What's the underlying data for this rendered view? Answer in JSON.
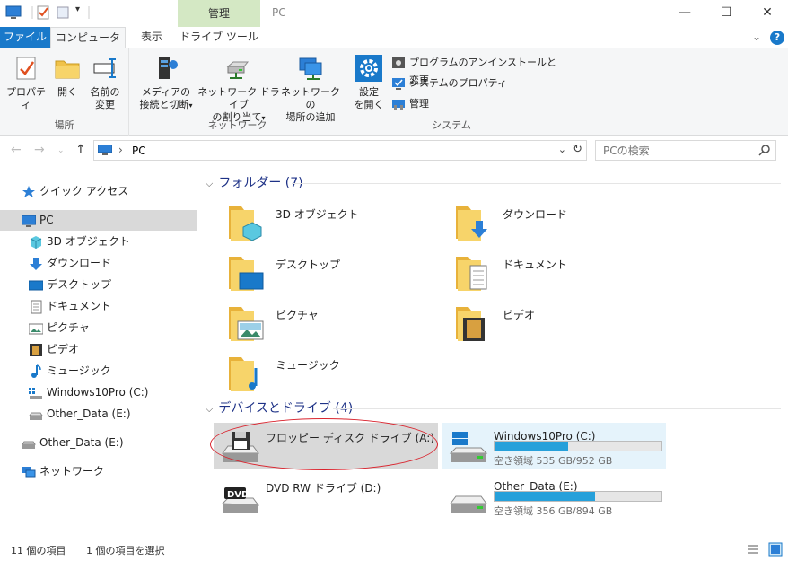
{
  "window": {
    "title": "PC",
    "context_tab": "管理",
    "buttons": {
      "minimize": "—",
      "maximize": "☐",
      "close": "✕"
    }
  },
  "tabs": {
    "file": "ファイル",
    "computer": "コンピューター",
    "view": "表示",
    "drive_tools": "ドライブ ツール",
    "help": "?"
  },
  "ribbon": {
    "location": {
      "label": "場所",
      "properties": "プロパティ",
      "open": "開く",
      "rename_1": "名前の",
      "rename_2": "変更"
    },
    "network": {
      "label": "ネットワーク",
      "media_1": "メディアの",
      "media_2": "接続と切断",
      "netdrive_1": "ネットワーク ドライブ",
      "netdrive_2": "の割り当て",
      "netloc_1": "ネットワークの",
      "netloc_2": "場所の追加"
    },
    "system": {
      "label": "システム",
      "settings_1": "設定",
      "settings_2": "を開く",
      "uninstall": "プログラムのアンインストールと変更",
      "sysprops": "システムのプロパティ",
      "manage": "管理"
    }
  },
  "address": {
    "separator": "›",
    "path": "PC",
    "search_placeholder": "PCの検索"
  },
  "navpane": {
    "quick_access": "クイック アクセス",
    "pc": "PC",
    "items": [
      "3D オブジェクト",
      "ダウンロード",
      "デスクトップ",
      "ドキュメント",
      "ピクチャ",
      "ビデオ",
      "ミュージック",
      "Windows10Pro (C:)",
      "Other_Data (E:)"
    ],
    "other_data": "Other_Data (E:)",
    "network": "ネットワーク"
  },
  "content": {
    "folders_header": "フォルダー (7)",
    "folders": [
      "3D オブジェクト",
      "ダウンロード",
      "デスクトップ",
      "ドキュメント",
      "ピクチャ",
      "ビデオ",
      "ミュージック"
    ],
    "devices_header": "デバイスとドライブ (4)",
    "drives": [
      {
        "name": "フロッピー ディスク ドライブ (A:)"
      },
      {
        "name": "Windows10Pro (C:)",
        "free": "空き領域 535 GB/952 GB",
        "used_fraction": 0.44
      },
      {
        "name": "DVD RW ドライブ (D:)",
        "badge": "DVD"
      },
      {
        "name": "Other_Data (E:)",
        "free": "空き領域 356 GB/894 GB",
        "used_fraction": 0.6
      }
    ]
  },
  "status": {
    "count": "11 個の項目",
    "selected": "1 個の項目を選択"
  },
  "colors": {
    "accent": "#1979ca",
    "context_tab": "#d4e8c4",
    "selection": "#d9d9d9",
    "hover": "#e5f3fb",
    "bar_fill": "#26a0da",
    "annotation": "#d9232d"
  }
}
